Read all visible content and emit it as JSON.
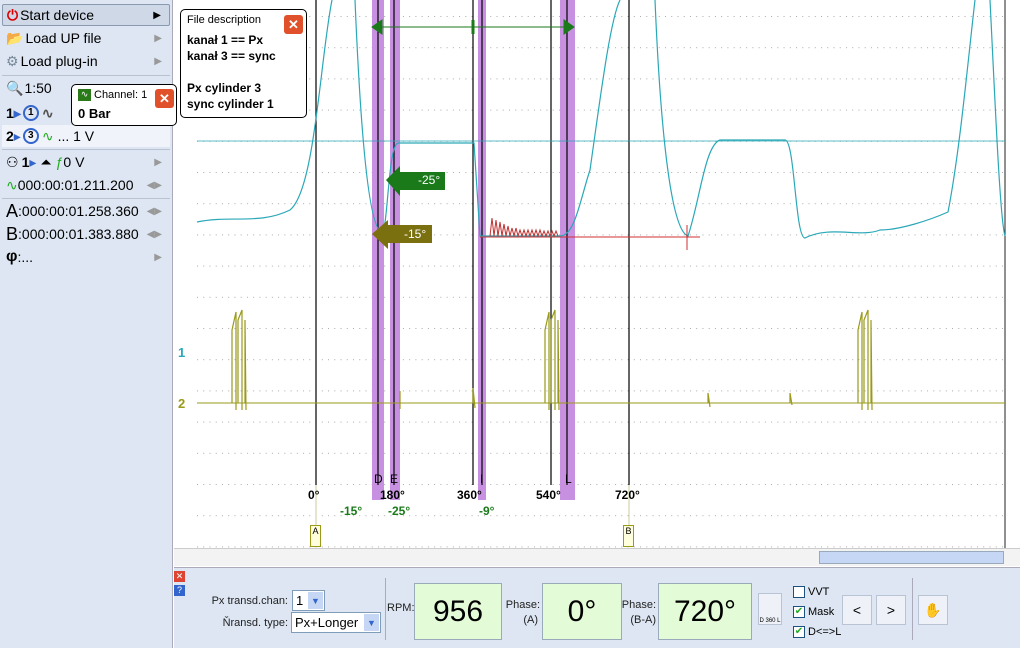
{
  "menu": {
    "start": "Start device",
    "load_up": "Load UP file",
    "load_plugin": "Load plug-in"
  },
  "zoom": "1:50",
  "ch1": {
    "num": "1",
    "chan": "1"
  },
  "ch2": {
    "num": "2",
    "chan": "3",
    "value": "... 1 V"
  },
  "trigger": {
    "num": "1",
    "level": "0 V"
  },
  "pretrigger": "000:00:01.211.200",
  "cursor_a": {
    "label": "A",
    "value": ":000:00:01.258.360"
  },
  "cursor_b": {
    "label": "B",
    "value": ":000:00:01.383.880"
  },
  "phi": {
    "label": "φ",
    "value": ":..."
  },
  "file_desc": {
    "title": "File description",
    "lines": [
      "kanał 1 == Px",
      "kanał 3 == sync",
      "",
      "Px cylinder 3",
      "sync cylinder 1"
    ]
  },
  "channel_popup": {
    "title": "Channel: 1",
    "value": "0 Bar"
  },
  "plot": {
    "degree_labels": [
      "0°",
      "180°",
      "360°",
      "540°",
      "720°"
    ],
    "marker_letters": [
      "D",
      "E",
      "I",
      "L"
    ],
    "angle_labels": [
      "-15°",
      "-25°",
      "-9°"
    ],
    "arrow_labels": [
      "-25°",
      "-15°"
    ],
    "channel_markers": [
      "1",
      "2"
    ],
    "cursor_tags": [
      "A",
      "B"
    ],
    "colors": {
      "ch1": "#2aa8b8",
      "ch2": "#9a9a1a",
      "band": "#c890e0",
      "green": "#1a7a1a",
      "olive": "#7a7010"
    }
  },
  "bottom": {
    "px_chan_label": "Px transd.chan:",
    "px_chan_value": "1",
    "type_label": "Ňransd. type:",
    "type_value": "Px+Longer",
    "rpm_label": "RPM:",
    "rpm": "956",
    "phase_a_label": "Phase:",
    "phase_a_sub": "(A)",
    "phase_a": "0°",
    "phase_ba_label": "Phase:",
    "phase_ba_sub": "(B-A)",
    "phase_ba": "720°",
    "d360l": "D 360 L",
    "vvt": "VVT",
    "mask": "Mask",
    "dl": "D<=>L",
    "prev": "<",
    "next": ">",
    "hand": "✋"
  }
}
